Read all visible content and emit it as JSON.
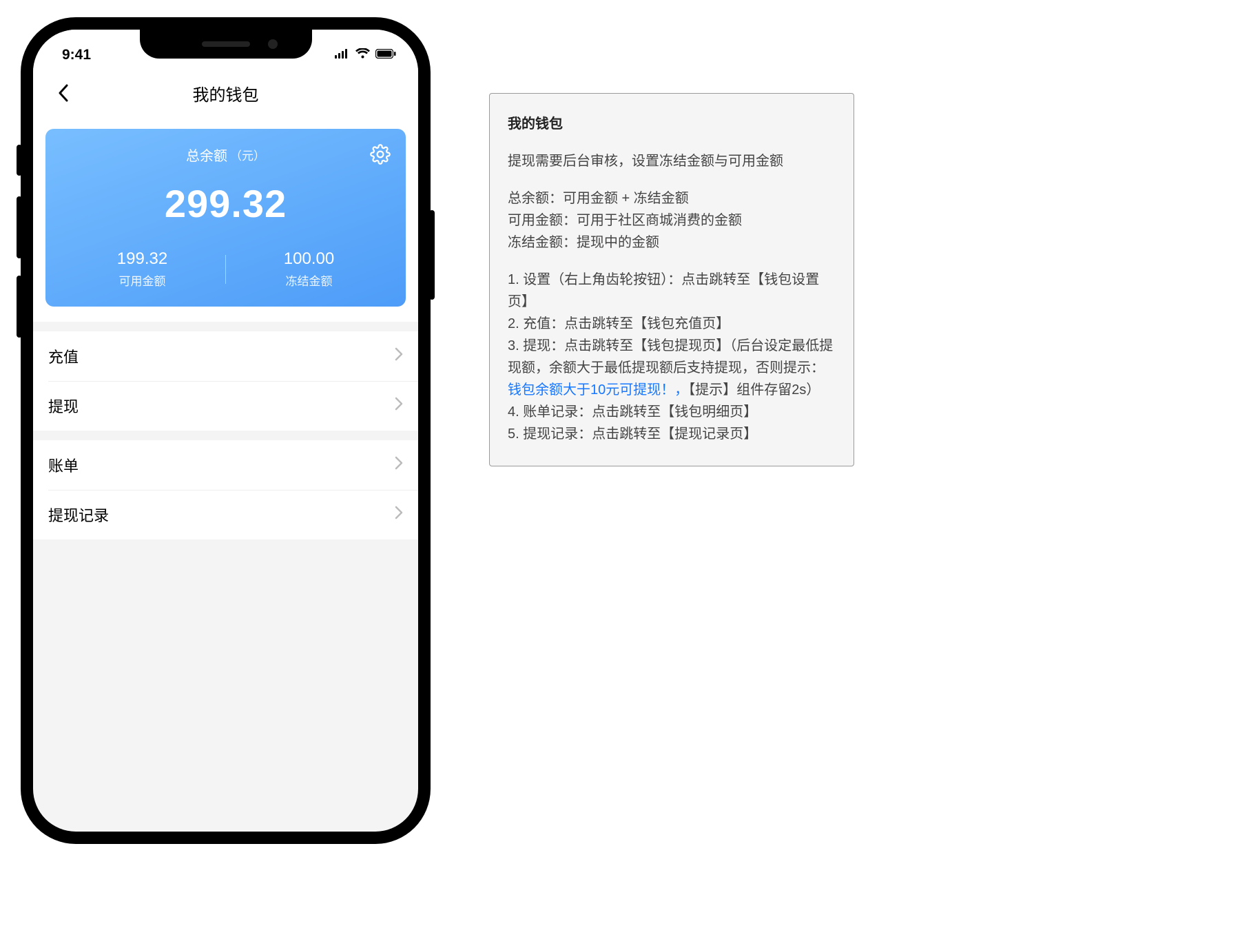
{
  "status": {
    "time": "9:41"
  },
  "nav": {
    "title": "我的钱包"
  },
  "card": {
    "title": "总余额",
    "unit": "（元）",
    "total": "299.32",
    "available": {
      "value": "199.32",
      "label": "可用金额"
    },
    "frozen": {
      "value": "100.00",
      "label": "冻结金额"
    }
  },
  "menu": {
    "group1": [
      {
        "label": "充值"
      },
      {
        "label": "提现"
      }
    ],
    "group2": [
      {
        "label": "账单"
      },
      {
        "label": "提现记录"
      }
    ]
  },
  "spec": {
    "title": "我的钱包",
    "intro": "提现需要后台审核，设置冻结金额与可用金额",
    "defs": [
      "总余额：可用金额 + 冻结金额",
      "可用金额：可用于社区商城消费的金额",
      "冻结金额：提现中的金额"
    ],
    "items": [
      {
        "pre": "1. 设置（右上角齿轮按钮）：点击跳转至【钱包设置页】"
      },
      {
        "pre": "2. 充值：点击跳转至【钱包充值页】"
      },
      {
        "pre": "3. 提现：点击跳转至【钱包提现页】（后台设定最低提现额，余额大于最低提现额后支持提现，否则提示：",
        "link": "钱包余额大于10元可提现！，",
        "post": "【提示】组件存留2s）"
      },
      {
        "pre": "4. 账单记录：点击跳转至【钱包明细页】"
      },
      {
        "pre": "5. 提现记录：点击跳转至【提现记录页】"
      }
    ]
  }
}
